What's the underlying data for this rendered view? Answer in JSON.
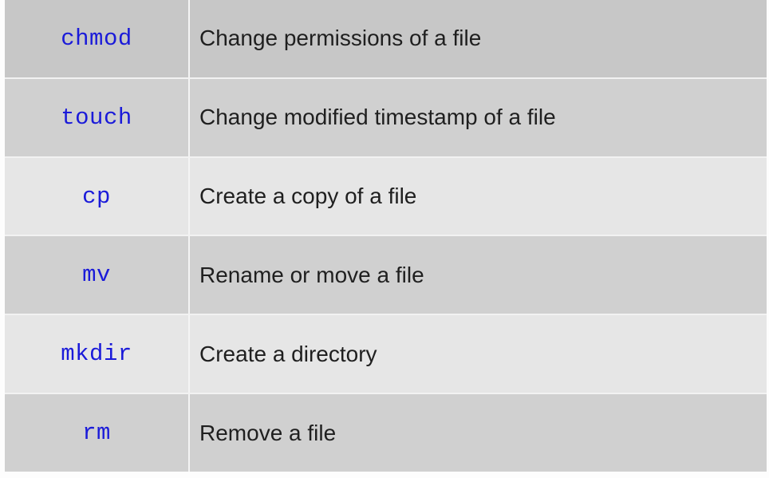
{
  "commands": [
    {
      "name": "chmod",
      "description": "Change permissions of a file"
    },
    {
      "name": "touch",
      "description": "Change modified timestamp of a file"
    },
    {
      "name": "cp",
      "description": "Create a copy of a file"
    },
    {
      "name": "mv",
      "description": "Rename or move a file"
    },
    {
      "name": "mkdir",
      "description": "Create a directory"
    },
    {
      "name": "rm",
      "description": "Remove a file"
    }
  ],
  "colors": {
    "command_text": "#1a1ad9",
    "description_text": "#1f1f1f",
    "row_dark": "#c7c7c7",
    "row_mid": "#d0d0d0",
    "row_light": "#e6e6e6"
  }
}
